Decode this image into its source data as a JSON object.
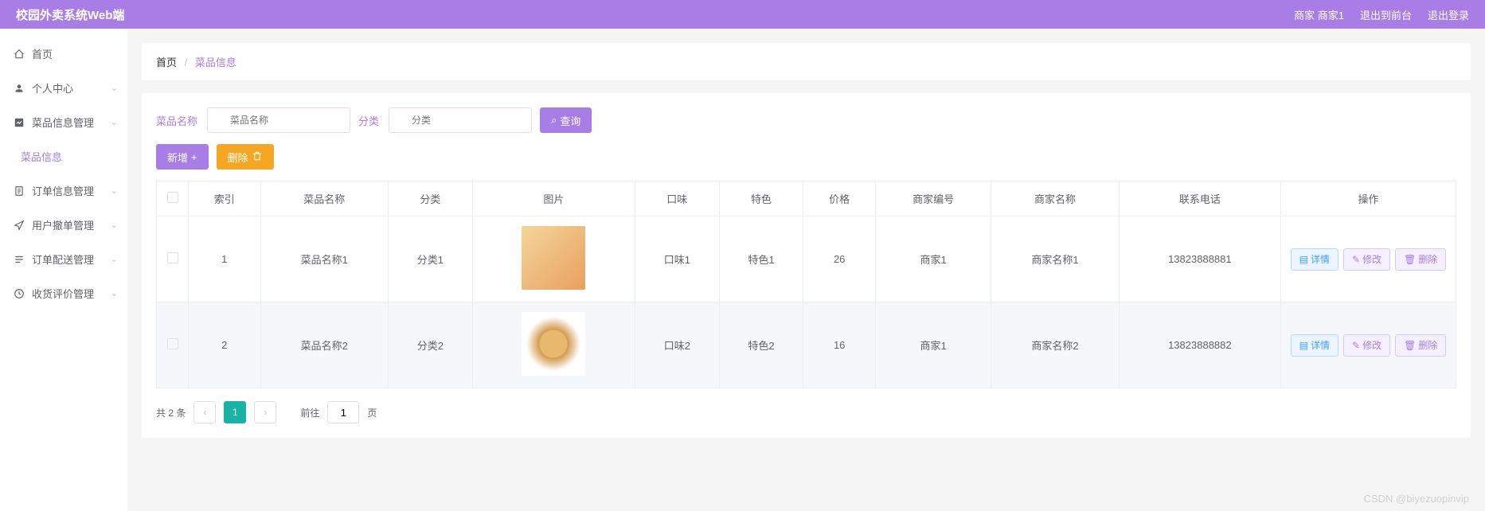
{
  "header": {
    "title": "校园外卖系统Web端",
    "user": "商家 商家1",
    "toFront": "退出到前台",
    "logout": "退出登录"
  },
  "sidebar": {
    "items": [
      {
        "label": "首页",
        "icon": "home"
      },
      {
        "label": "个人中心",
        "icon": "user",
        "expandable": true
      },
      {
        "label": "菜品信息管理",
        "icon": "chart",
        "expandable": true
      },
      {
        "label": "菜品信息",
        "sub": true
      },
      {
        "label": "订单信息管理",
        "icon": "doc",
        "expandable": true
      },
      {
        "label": "用户撤单管理",
        "icon": "send",
        "expandable": true
      },
      {
        "label": "订单配送管理",
        "icon": "list",
        "expandable": true
      },
      {
        "label": "收货评价管理",
        "icon": "clock",
        "expandable": true
      }
    ]
  },
  "breadcrumb": {
    "home": "首页",
    "current": "菜品信息"
  },
  "search": {
    "nameLabel": "菜品名称",
    "namePlaceholder": "菜品名称",
    "catLabel": "分类",
    "catPlaceholder": "分类",
    "queryBtn": "查询"
  },
  "actions": {
    "add": "新增",
    "delete": "删除"
  },
  "table": {
    "headers": [
      "",
      "索引",
      "菜品名称",
      "分类",
      "图片",
      "口味",
      "特色",
      "价格",
      "商家编号",
      "商家名称",
      "联系电话",
      "操作"
    ],
    "rows": [
      {
        "idx": "1",
        "name": "菜品名称1",
        "cat": "分类1",
        "taste": "口味1",
        "feature": "特色1",
        "price": "26",
        "mcode": "商家1",
        "mname": "商家名称1",
        "phone": "13823888881",
        "img": "dish"
      },
      {
        "idx": "2",
        "name": "菜品名称2",
        "cat": "分类2",
        "taste": "口味2",
        "feature": "特色2",
        "price": "16",
        "mcode": "商家1",
        "mname": "商家名称2",
        "phone": "13823888882",
        "img": "burger"
      }
    ],
    "rowActions": {
      "detail": "详情",
      "edit": "修改",
      "delete": "删除"
    }
  },
  "pagination": {
    "total": "共 2 条",
    "page": "1",
    "gotoLabel": "前往",
    "gotoValue": "1",
    "pageSuffix": "页"
  },
  "watermark": "CSDN @biyezuopinvip"
}
